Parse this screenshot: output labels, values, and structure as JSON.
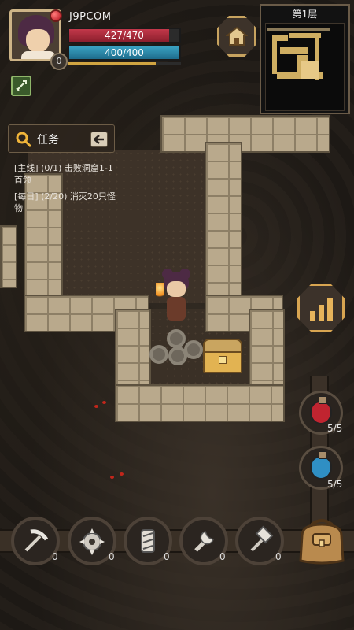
{
  "player": {
    "name": "J9PCOM",
    "level": "0",
    "hp_text": "427/470",
    "hp": 427,
    "hp_max": 470,
    "mp_text": "400/400",
    "mp": 400,
    "mp_max": 400,
    "xp_fraction": 0.78
  },
  "minimap": {
    "title": "第1层"
  },
  "quest": {
    "title": "任务",
    "items": [
      {
        "text": "[主线] (0/1) 击败洞窟1-1首领"
      },
      {
        "text": "[每日] (2/20) 消灭20只怪物"
      }
    ]
  },
  "potions": [
    {
      "name": "health-potion",
      "color": "#c02430",
      "count": "5/5"
    },
    {
      "name": "mana-potion",
      "color": "#2f8fc4",
      "count": "5/5"
    }
  ],
  "tools": [
    {
      "name": "pickaxe",
      "count": "0"
    },
    {
      "name": "spiked-bomb",
      "count": "0"
    },
    {
      "name": "scroll",
      "count": "0"
    },
    {
      "name": "wrench",
      "count": "0"
    },
    {
      "name": "hammer",
      "count": "0"
    }
  ],
  "colors": {
    "accent": "#d8a551",
    "hp": "#c3384a",
    "mp": "#3aa2c2"
  }
}
